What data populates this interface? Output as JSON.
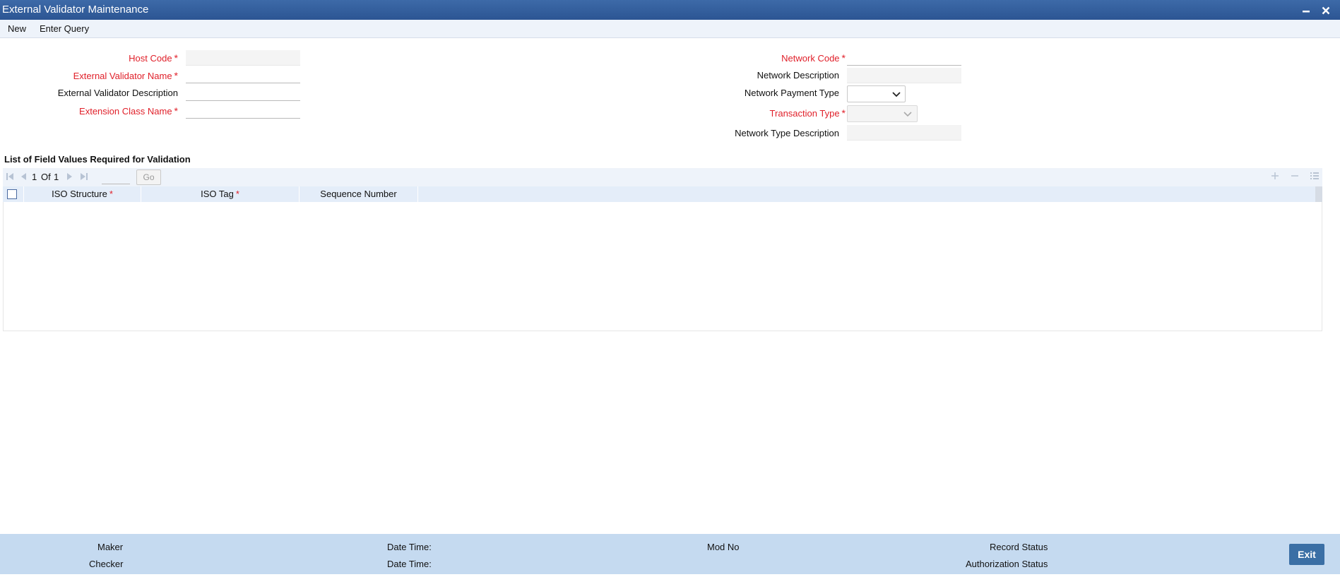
{
  "window": {
    "title": "External Validator Maintenance"
  },
  "menu": {
    "new": "New",
    "enter_query": "Enter Query"
  },
  "form_left": {
    "host_code": {
      "label": "Host Code",
      "value": ""
    },
    "external_validator_name": {
      "label": "External Validator Name",
      "value": ""
    },
    "external_validator_description": {
      "label": "External Validator Description",
      "value": ""
    },
    "extension_class_name": {
      "label": "Extension Class Name",
      "value": ""
    }
  },
  "form_right": {
    "network_code": {
      "label": "Network Code",
      "value": ""
    },
    "network_description": {
      "label": "Network Description",
      "value": ""
    },
    "network_payment_type": {
      "label": "Network Payment Type",
      "value": ""
    },
    "transaction_type": {
      "label": "Transaction Type",
      "value": ""
    },
    "network_type_description": {
      "label": "Network Type Description",
      "value": ""
    }
  },
  "required_marker": "*",
  "grid": {
    "title": "List of Field Values Required for Validation",
    "pager": {
      "current": "1",
      "of_label": "Of",
      "total": "1",
      "go_label": "Go"
    },
    "columns": [
      {
        "label": "ISO Structure",
        "required": true
      },
      {
        "label": "ISO Tag",
        "required": true
      },
      {
        "label": "Sequence Number",
        "required": false
      }
    ],
    "rows": []
  },
  "footer": {
    "maker": "Maker",
    "checker": "Checker",
    "date_time_1": "Date Time:",
    "date_time_2": "Date Time:",
    "mod_no": "Mod No",
    "record_status": "Record Status",
    "authorization_status": "Authorization Status",
    "exit": "Exit"
  },
  "colors": {
    "title_bar": "#2c5593",
    "required_label": "#e0202a",
    "footer_bg": "#c5daf0",
    "exit_button": "#3b6fa5"
  },
  "icons": [
    "minimize-icon",
    "close-icon",
    "first-page-icon",
    "prev-page-icon",
    "next-page-icon",
    "last-page-icon",
    "add-row-icon",
    "delete-row-icon",
    "single-view-icon",
    "chevron-down-icon"
  ]
}
